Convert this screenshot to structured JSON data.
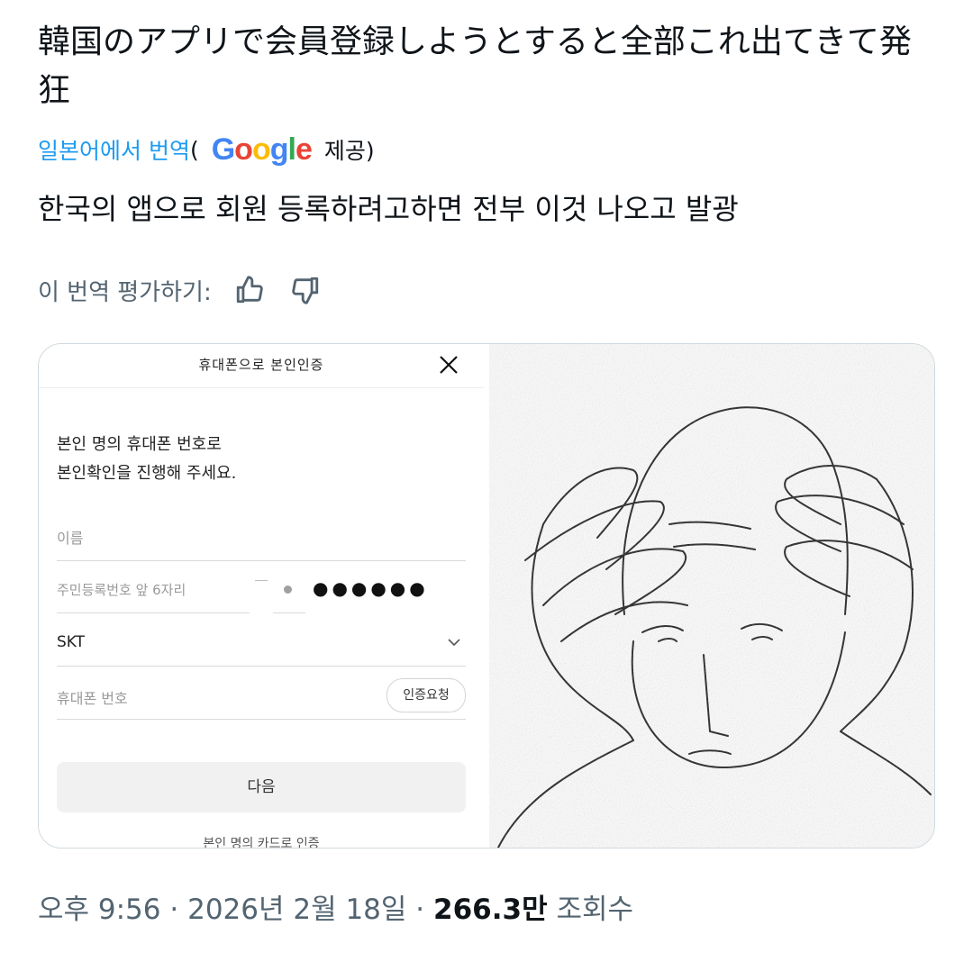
{
  "tweet": {
    "text": "韓国のアプリで会員登録しようとすると全部これ出てきて発狂",
    "translate_link": "일본어에서 번역",
    "paren_open": "(",
    "google_brand": "Google",
    "provided": "제공)",
    "translated_text": "한국의 앱으로 회원 등록하려고하면 전부 이것 나오고 발광",
    "rate_label": "이 번역 평가하기:",
    "thumbs_up_icon": "thumbs-up-icon",
    "thumbs_down_icon": "thumbs-down-icon"
  },
  "media": {
    "modal_title": "휴대폰으로 본인인증",
    "close_icon": "close-icon",
    "instruction_line1": "본인 명의 휴대폰 번호로",
    "instruction_line2": "본인확인을 진행해 주세요.",
    "name_placeholder": "이름",
    "ssn_placeholder": "주민등록번호 앞 6자리",
    "masked_digits": "●●●●●●",
    "carrier": "SKT",
    "phone_placeholder": "휴대폰 번호",
    "verify_button": "인증요청",
    "next_button": "다음",
    "card_auth": "본인 명의 카드로 인증",
    "illustration": "bald-man-holding-head-illustration"
  },
  "meta": {
    "time": "오후 9:56",
    "sep1": "·",
    "date": "2026년 2월 18일",
    "sep2": "·",
    "views_count": "266.3만",
    "views_label": "조회수"
  },
  "colors": {
    "link_blue": "#1d9bf0",
    "secondary_text": "#536471",
    "primary_text": "#0f1419",
    "google_blue": "#4285F4",
    "google_red": "#EA4335",
    "google_yellow": "#FBBC05",
    "google_green": "#34A853"
  }
}
